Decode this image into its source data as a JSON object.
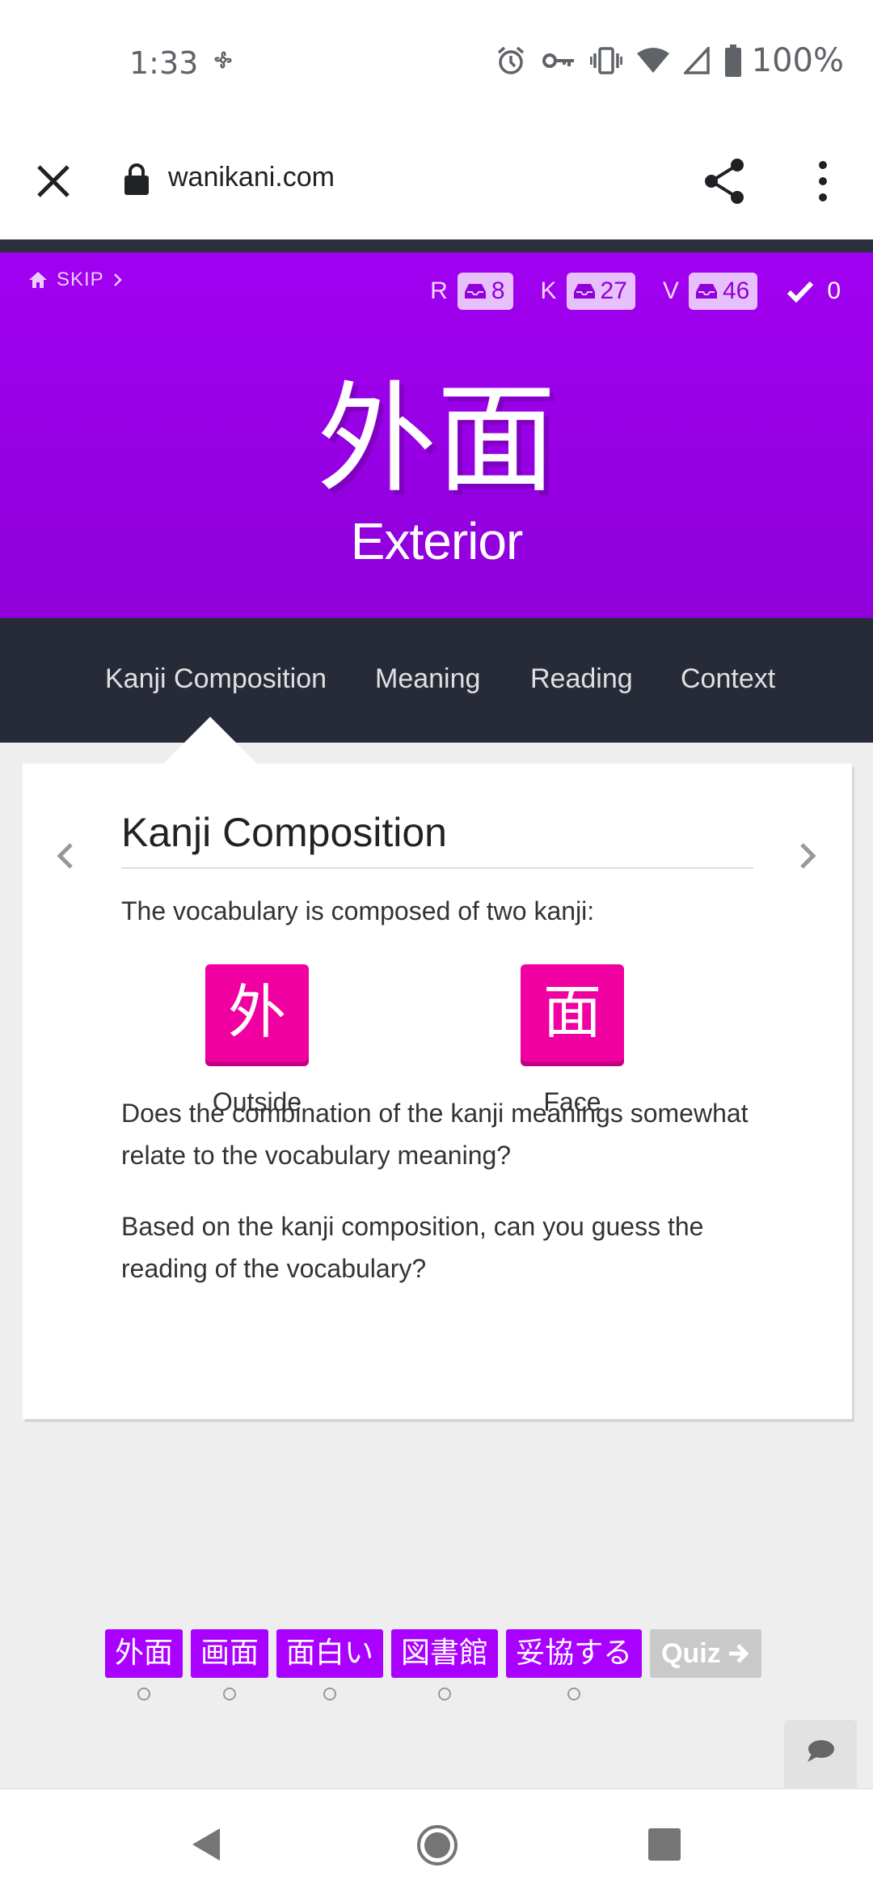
{
  "status_bar": {
    "time": "1:33",
    "battery": "100%"
  },
  "browser": {
    "url": "wanikani.com"
  },
  "header": {
    "skip_label": "SKIP",
    "counts": [
      {
        "label": "R",
        "value": "8"
      },
      {
        "label": "K",
        "value": "27"
      },
      {
        "label": "V",
        "value": "46"
      }
    ],
    "done_count": "0",
    "character": "外面",
    "meaning": "Exterior",
    "colors": {
      "vocab": "#aa00ff",
      "kanji": "#f100a1",
      "tabs_bg": "#272b38"
    }
  },
  "tabs": [
    {
      "label": "Kanji Composition",
      "active": true
    },
    {
      "label": "Meaning"
    },
    {
      "label": "Reading"
    },
    {
      "label": "Context"
    }
  ],
  "card": {
    "title": "Kanji Composition",
    "intro": "The vocabulary is composed of two kanji:",
    "kanji": [
      {
        "character": "外",
        "meaning": "Outside"
      },
      {
        "character": "面",
        "meaning": "Face"
      }
    ],
    "question1": "Does the combination of the kanji meanings somewhat relate to the vocabulary meaning?",
    "question2": "Based on the kanji composition, can you guess the reading of the vocabulary?"
  },
  "queue": {
    "items": [
      "外面",
      "画面",
      "面白い",
      "図書館",
      "妥協する"
    ],
    "quiz_label": "Quiz"
  },
  "icons": [
    "home-icon",
    "chevron-right-icon",
    "inbox-icon",
    "check-icon",
    "chevron-left-icon",
    "chat-icon",
    "lock-icon",
    "share-icon",
    "more-vert-icon",
    "close-icon"
  ]
}
